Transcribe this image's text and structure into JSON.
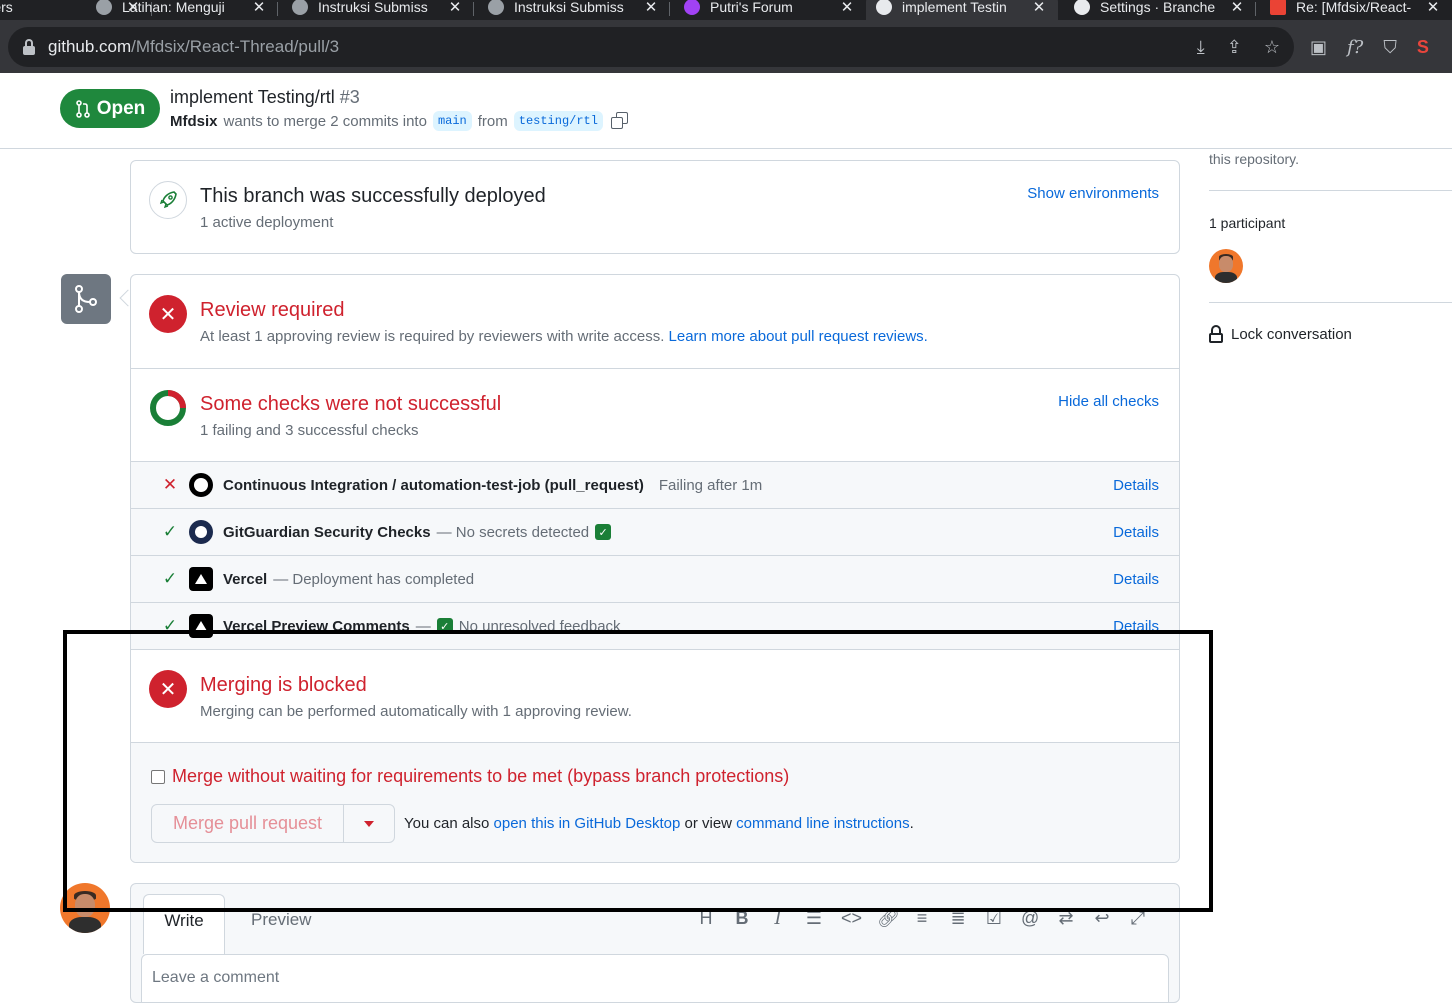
{
  "browser": {
    "tabs": [
      {
        "title": "adners",
        "close": "✕"
      },
      {
        "title": "Latihan: Menguji",
        "close": "✕"
      },
      {
        "title": "Instruksi Submiss",
        "close": "✕"
      },
      {
        "title": "Instruksi Submiss",
        "close": "✕"
      },
      {
        "title": "Putri's Forum",
        "close": "✕"
      },
      {
        "title": "implement Testin",
        "close": "✕"
      },
      {
        "title": "Settings · Branche",
        "close": "✕"
      },
      {
        "title": "Re: [Mfdsix/React-",
        "close": "✕"
      }
    ],
    "active_tab_index": 5,
    "url_host": "github.com",
    "url_path": "/Mfdsix/React-Thread/pull/3"
  },
  "pr": {
    "state_label": "Open",
    "title": "implement Testing/rtl",
    "number": "#3",
    "author": "Mfdsix",
    "merge_text": "wants to merge 2 commits into",
    "base_branch": "main",
    "from_text": "from",
    "head_branch": "testing/rtl"
  },
  "deployment": {
    "title": "This branch was successfully deployed",
    "subtitle": "1 active deployment",
    "show_link": "Show environments"
  },
  "review": {
    "title": "Review required",
    "subtitle": "At least 1 approving review is required by reviewers with write access.",
    "learn_link": "Learn more about pull request reviews."
  },
  "checks": {
    "title": "Some checks were not successful",
    "subtitle": "1 failing and 3 successful checks",
    "hide_link": "Hide all checks",
    "items": [
      {
        "status": "fail",
        "name": "Continuous Integration / automation-test-job (pull_request)",
        "desc": "Failing after 1m",
        "details": "Details",
        "icon": "github-icon"
      },
      {
        "status": "ok",
        "name": "GitGuardian Security Checks",
        "desc": "— No secrets detected",
        "details": "Details",
        "icon": "gitguardian-icon"
      },
      {
        "status": "ok",
        "name": "Vercel",
        "desc": "— Deployment has completed",
        "details": "Details",
        "icon": "vercel-icon"
      },
      {
        "status": "ok",
        "name": "Vercel Preview Comments",
        "desc": "—",
        "desc2": "No unresolved feedback",
        "details": "Details",
        "icon": "vercel-icon"
      }
    ]
  },
  "merge": {
    "title": "Merging is blocked",
    "subtitle": "Merging can be performed automatically with 1 approving review.",
    "bypass_label": "Merge without waiting for requirements to be met (bypass branch protections)",
    "button_label": "Merge pull request",
    "also_text": "You can also",
    "desktop_link": "open this in GitHub Desktop",
    "or_view": "or view",
    "cli_link": "command line instructions",
    "period": "."
  },
  "comment": {
    "write_tab": "Write",
    "preview_tab": "Preview",
    "placeholder": "Leave a comment"
  },
  "sidebar": {
    "repo_text": "this repository.",
    "participants": "1 participant",
    "lock": "Lock conversation"
  },
  "colors": {
    "open_green": "#1f883d",
    "danger_red": "#cf222e",
    "link_blue": "#0969da",
    "success_green": "#1a7f37"
  }
}
